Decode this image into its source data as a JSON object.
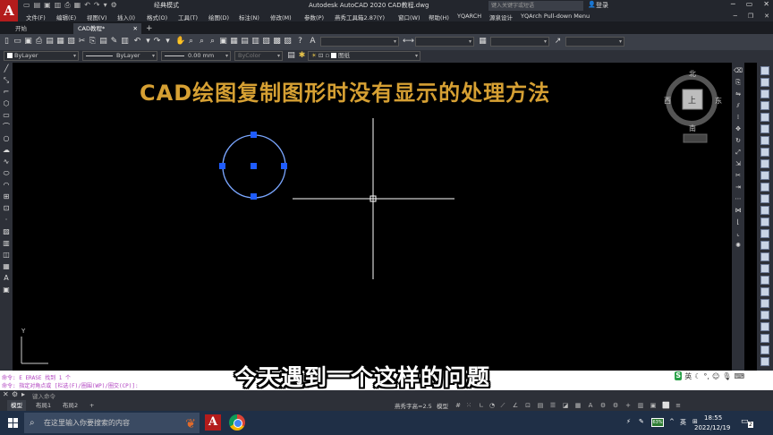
{
  "titlebar": {
    "logo": "A",
    "workspace": "经典模式",
    "app_title": "Autodesk AutoCAD 2020    CAD教程.dwg",
    "help_search_placeholder": "键入关键字或短语",
    "login": "登录"
  },
  "menu": [
    "文件(F)",
    "编辑(E)",
    "视图(V)",
    "插入(I)",
    "格式(O)",
    "工具(T)",
    "绘图(D)",
    "标注(N)",
    "修改(M)",
    "参数(P)",
    "燕秀工具箱2.87(Y)",
    "窗口(W)",
    "帮助(H)",
    "YQARCH",
    "源泉设计",
    "YQArch Pull-down Menu"
  ],
  "tabs": [
    {
      "label": "开始",
      "active": false
    },
    {
      "label": "CAD教程*",
      "active": true
    }
  ],
  "toolbar2": {
    "layer_combo": "ByLayer",
    "linetype_combo": "ByLayer",
    "lineweight_combo": "0.00 mm",
    "color_combo": "ByColor",
    "layer_name": "图纸"
  },
  "canvas": {
    "banner_text": "CAD绘图复制图形时没有显示的处理方法",
    "viewcube": {
      "north": "北",
      "south": "南",
      "east": "东",
      "west": "西",
      "top": "上"
    },
    "ucs_y": "Y",
    "colors": {
      "banner": "#d6a033",
      "circle": "#7aa6ff",
      "grip": "#1f5cff"
    }
  },
  "command": {
    "history": [
      "命令: E ERASE 找到 1 个",
      "命令: 指定对角点或 [栏选(F)/圈围(WP)/圈交(CP)]:"
    ],
    "input_placeholder": "键入命令"
  },
  "subtitle": "今天遇到一个这样的问题",
  "ime": {
    "logo": "S",
    "lang": "英"
  },
  "status": {
    "layout_tabs": [
      {
        "label": "模型",
        "active": true
      },
      {
        "label": "布局1",
        "active": false
      },
      {
        "label": "布局2",
        "active": false
      }
    ],
    "font_info": "燕秀字高=2.5",
    "mode": "模型"
  },
  "taskbar": {
    "search_placeholder": "在这里输入你要搜索的内容",
    "battery": "63%",
    "ime": "英",
    "time": "18:55",
    "date": "2022/12/19",
    "notif": "2"
  }
}
